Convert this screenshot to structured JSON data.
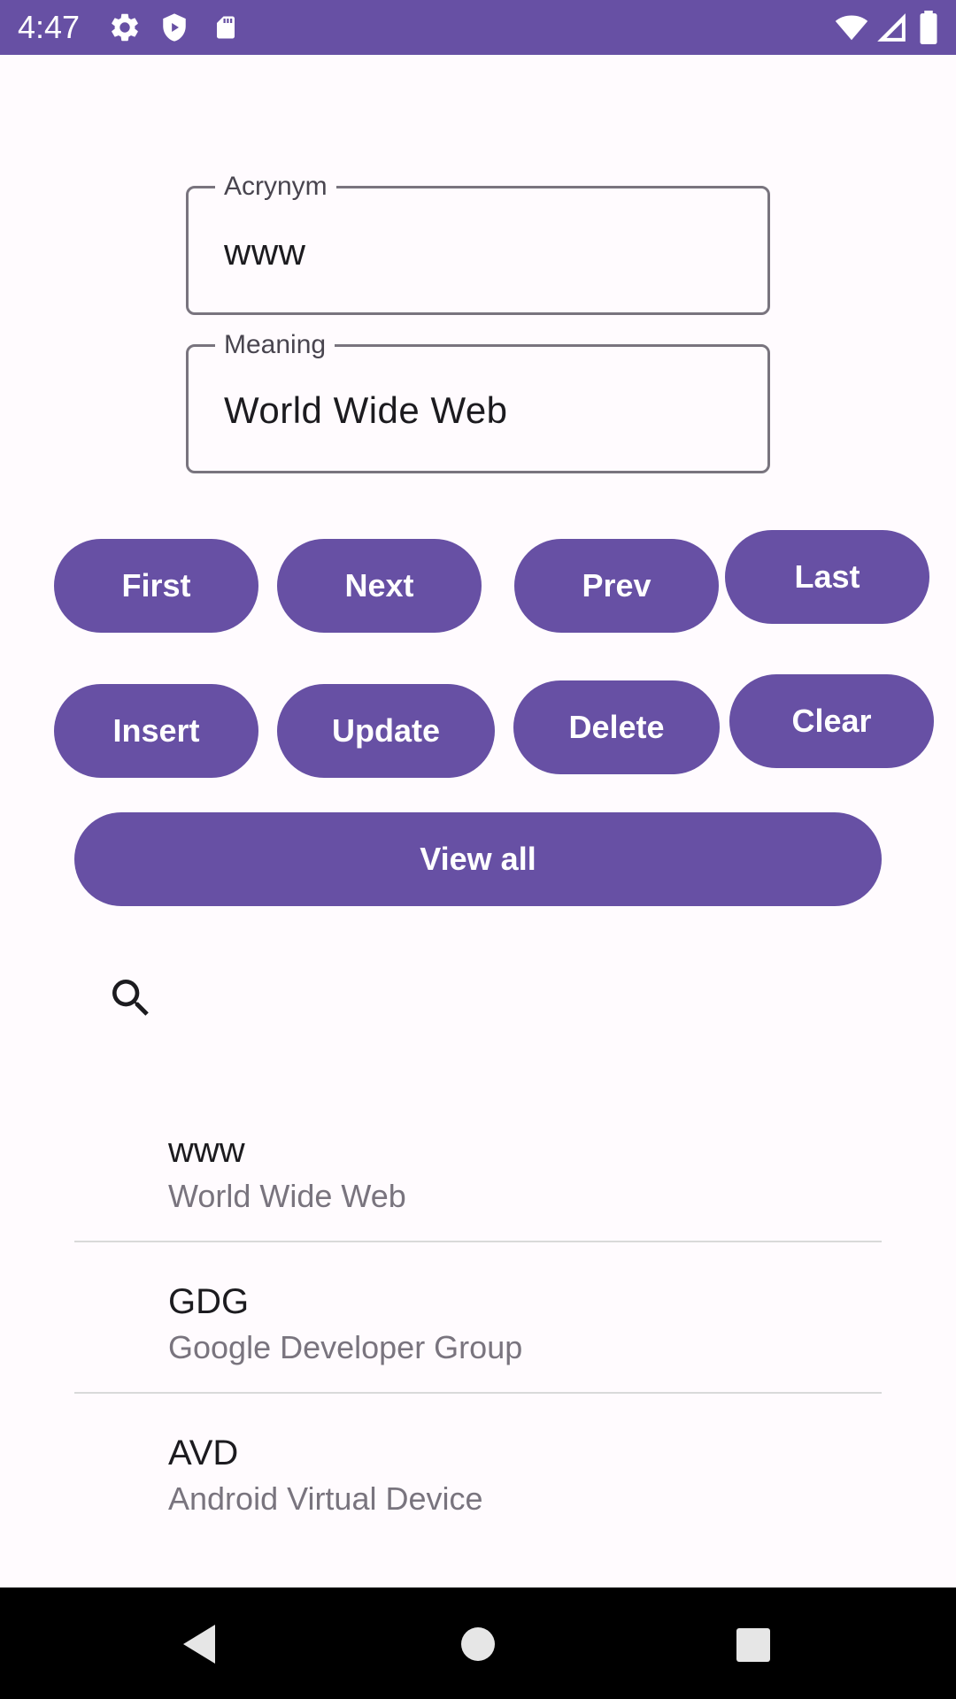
{
  "status_bar": {
    "time": "4:47",
    "left_icons": [
      "gear-icon",
      "shield-icon",
      "sd-card-icon"
    ],
    "right_icons": [
      "wifi-icon",
      "signal-icon",
      "battery-icon"
    ]
  },
  "form": {
    "acronym": {
      "label": "Acrynym",
      "value": "www"
    },
    "meaning": {
      "label": "Meaning",
      "value": "World Wide Web"
    }
  },
  "buttons": {
    "first": "First",
    "next": "Next",
    "prev": "Prev",
    "last": "Last",
    "insert": "Insert",
    "update": "Update",
    "delete": "Delete",
    "clear": "Clear",
    "view_all": "View all"
  },
  "search": {
    "icon": "search-icon"
  },
  "list": {
    "items": [
      {
        "title": "www",
        "subtitle": "World Wide Web"
      },
      {
        "title": "GDG",
        "subtitle": "Google Developer Group"
      },
      {
        "title": "AVD",
        "subtitle": "Android Virtual Device"
      }
    ]
  },
  "nav_bar": {
    "icons": [
      "back-icon",
      "home-icon",
      "recents-icon"
    ]
  },
  "colors": {
    "primary": "#6750a4",
    "background": "#fffbfe",
    "outline": "#79747e",
    "text": "#1c1b1f",
    "secondary_text": "#79747e",
    "nav_bar": "#000000"
  }
}
